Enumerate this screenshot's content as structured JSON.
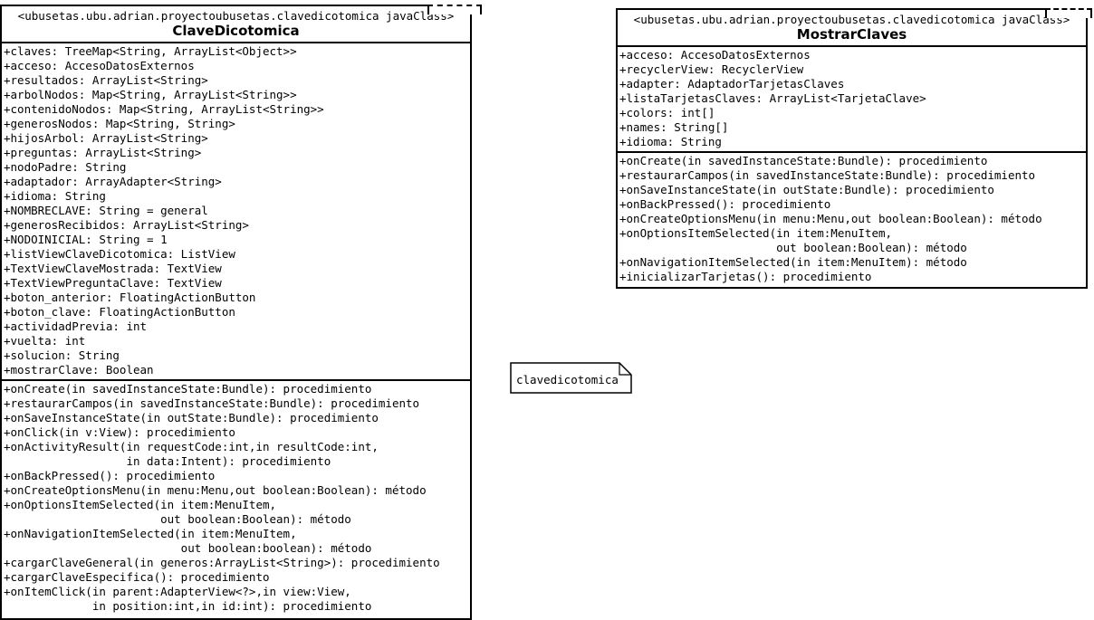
{
  "classes": [
    {
      "stereotype": "<ubusetas.ubu.adrian.proyectoubusetas.clavedicotomica javaClass>",
      "name": "ClaveDicotomica",
      "attributes": [
        "+claves: TreeMap<String, ArrayList<Object>>",
        "+acceso: AccesoDatosExternos",
        "+resultados: ArrayList<String>",
        "+arbolNodos: Map<String, ArrayList<String>>",
        "+contenidoNodos: Map<String, ArrayList<String>>",
        "+generosNodos: Map<String, String>",
        "+hijosArbol: ArrayList<String>",
        "+preguntas: ArrayList<String>",
        "+nodoPadre: String",
        "+adaptador: ArrayAdapter<String>",
        "+idioma: String",
        "+NOMBRECLAVE: String = general",
        "+generosRecibidos: ArrayList<String>",
        "+NODOINICIAL: String = 1",
        "+listViewClaveDicotomica: ListView",
        "+TextViewClaveMostrada: TextView",
        "+TextViewPreguntaClave: TextView",
        "+boton_anterior: FloatingActionButton",
        "+boton_clave: FloatingActionButton",
        "+actividadPrevia: int",
        "+vuelta: int",
        "+solucion: String",
        "+mostrarClave: Boolean"
      ],
      "operations": [
        "+onCreate(in savedInstanceState:Bundle): procedimiento",
        "+restaurarCampos(in savedInstanceState:Bundle): procedimiento",
        "+onSaveInstanceState(in outState:Bundle): procedimiento",
        "+onClick(in v:View): procedimiento",
        "+onActivityResult(in requestCode:int,in resultCode:int,",
        "                  in data:Intent): procedimiento",
        "+onBackPressed(): procedimiento",
        "+onCreateOptionsMenu(in menu:Menu,out boolean:Boolean): método",
        "+onOptionsItemSelected(in item:MenuItem,",
        "                       out boolean:Boolean): método",
        "+onNavigationItemSelected(in item:MenuItem,",
        "                          out boolean:boolean): método",
        "+cargarClaveGeneral(in generos:ArrayList<String>): procedimiento",
        "+cargarClaveEspecifica(): procedimiento",
        "+onItemClick(in parent:AdapterView<?>,in view:View,",
        "             in position:int,in id:int): procedimiento"
      ]
    },
    {
      "stereotype": "<ubusetas.ubu.adrian.proyectoubusetas.clavedicotomica javaClass>",
      "name": "MostrarClaves",
      "attributes": [
        "+acceso: AccesoDatosExternos",
        "+recyclerView: RecyclerView",
        "+adapter: AdaptadorTarjetasClaves",
        "+listaTarjetasClaves: ArrayList<TarjetaClave>",
        "+colors: int[]",
        "+names: String[]",
        "+idioma: String"
      ],
      "operations": [
        "+onCreate(in savedInstanceState:Bundle): procedimiento",
        "+restaurarCampos(in savedInstanceState:Bundle): procedimiento",
        "+onSaveInstanceState(in outState:Bundle): procedimiento",
        "+onBackPressed(): procedimiento",
        "+onCreateOptionsMenu(in menu:Menu,out boolean:Boolean): método",
        "+onOptionsItemSelected(in item:MenuItem,",
        "                       out boolean:Boolean): método",
        "+onNavigationItemSelected(in item:MenuItem): método",
        "+inicializarTarjetas(): procedimiento"
      ]
    }
  ],
  "package": {
    "label": "clavedicotomica"
  }
}
